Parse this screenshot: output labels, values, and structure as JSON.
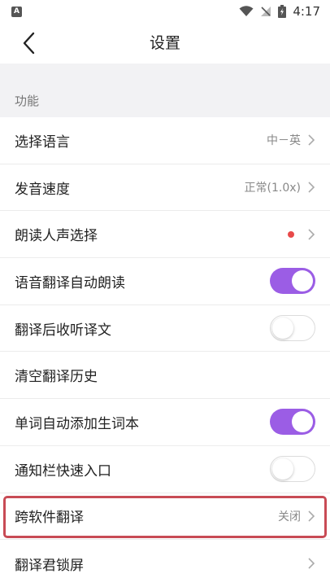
{
  "status_bar": {
    "notification_letter": "A",
    "time": "4:17"
  },
  "header": {
    "title": "设置"
  },
  "section": {
    "title": "功能"
  },
  "rows": [
    {
      "label": "选择语言",
      "value": "中－英",
      "control": "chevron"
    },
    {
      "label": "发音速度",
      "value": "正常(1.0x)",
      "control": "chevron"
    },
    {
      "label": "朗读人声选择",
      "value": "",
      "control": "dot-chevron"
    },
    {
      "label": "语音翻译自动朗读",
      "control": "toggle",
      "toggle_state": "on"
    },
    {
      "label": "翻译后收听译文",
      "control": "toggle",
      "toggle_state": "off"
    },
    {
      "label": "清空翻译历史",
      "control": "none"
    },
    {
      "label": "单词自动添加生词本",
      "control": "toggle",
      "toggle_state": "on"
    },
    {
      "label": "通知栏快速入口",
      "control": "toggle",
      "toggle_state": "off"
    },
    {
      "label": "跨软件翻译",
      "value": "关闭",
      "control": "chevron"
    },
    {
      "label": "翻译君锁屏",
      "value": "",
      "control": "chevron"
    }
  ],
  "colors": {
    "accent": "#9b5de5",
    "dot": "#e84a4a",
    "highlight": "#c84b55"
  }
}
